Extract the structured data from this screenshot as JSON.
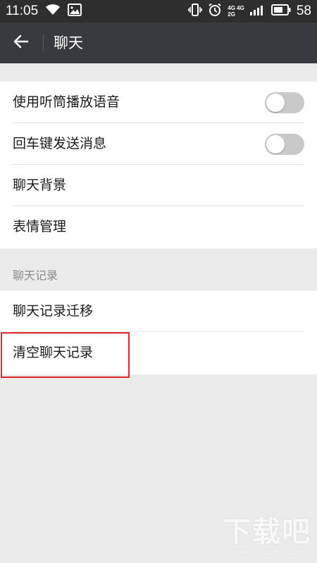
{
  "status_bar": {
    "time": "11:05",
    "network_top": "4G 4G",
    "network_bottom": "2G",
    "battery_percent": "58",
    "icons": [
      "wifi-icon",
      "image-icon",
      "vibrate-icon",
      "alarm-icon",
      "signal-icon",
      "battery-icon"
    ]
  },
  "header": {
    "back_icon": "arrow-left-icon",
    "title": "聊天",
    "background_color": "#393a3f"
  },
  "settings_group_1": {
    "items": [
      {
        "label": "使用听筒播放语音",
        "control": "toggle",
        "enabled": false
      },
      {
        "label": "回车键发送消息",
        "control": "toggle",
        "enabled": false
      },
      {
        "label": "聊天背景"
      },
      {
        "label": "表情管理"
      }
    ]
  },
  "chat_history_section": {
    "header": "聊天记录",
    "items": [
      {
        "label": "聊天记录迁移"
      },
      {
        "label": "清空聊天记录",
        "highlighted": true
      }
    ]
  },
  "colors": {
    "highlight_border": "#e0242b",
    "toggle_off": "#c9c9c9",
    "page_background": "#ebebeb"
  },
  "watermark": {
    "text": "下载吧",
    "url": "www.xiazaiba.com"
  }
}
